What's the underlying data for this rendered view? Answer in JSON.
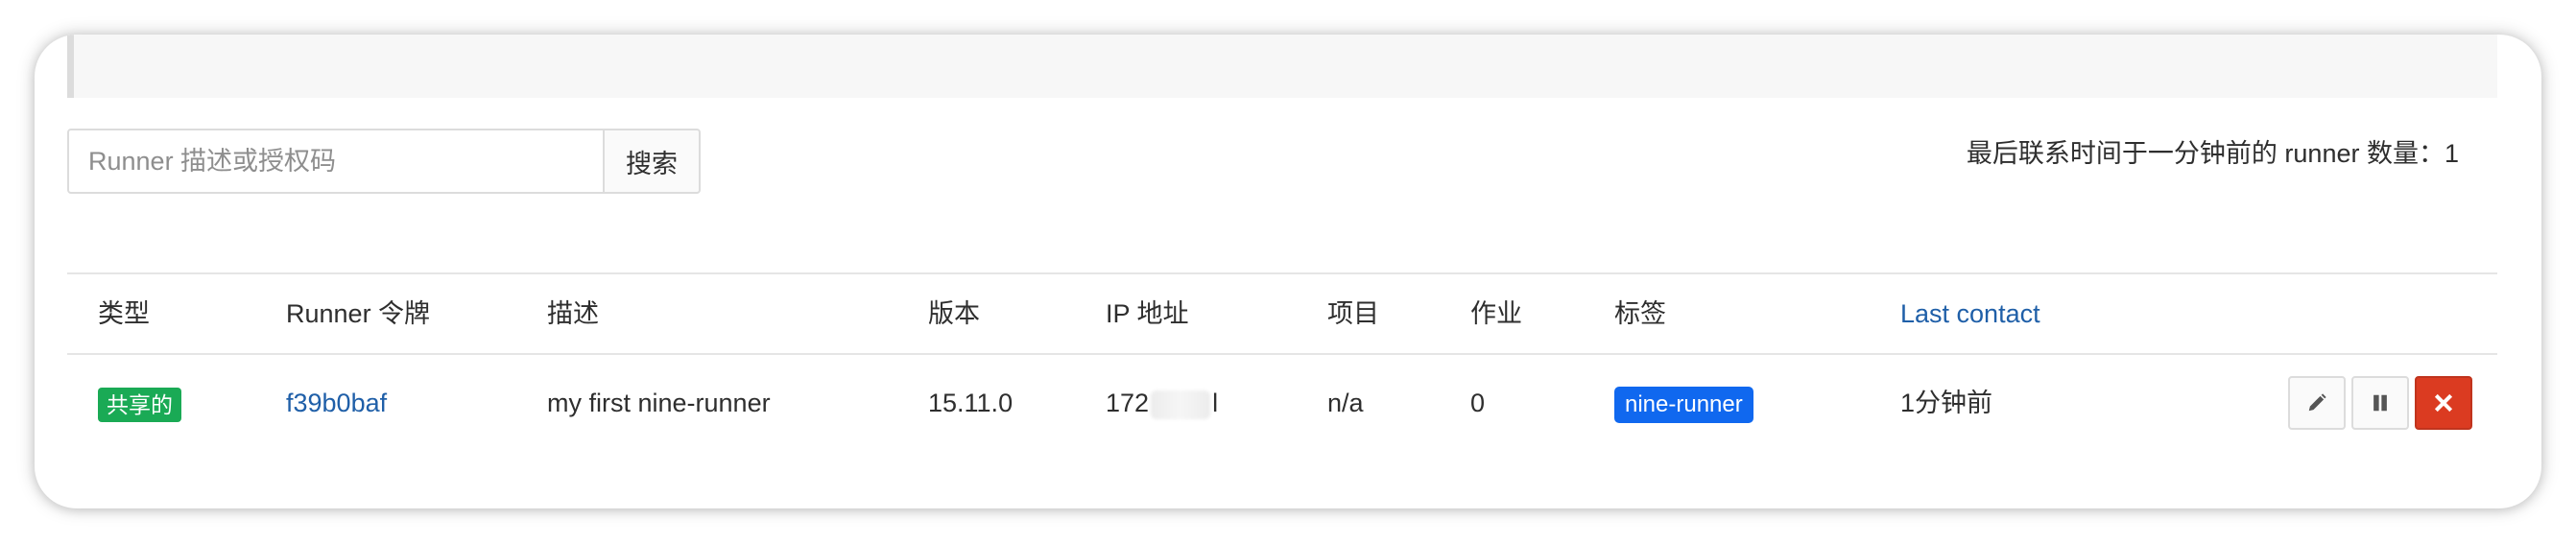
{
  "search": {
    "placeholder": "Runner 描述或授权码",
    "value": "",
    "button_label": "搜索"
  },
  "online_count_text": "最后联系时间于一分钟前的 runner 数量：1",
  "table": {
    "headers": {
      "type": "类型",
      "token": "Runner 令牌",
      "description": "描述",
      "version": "版本",
      "ip": "IP 地址",
      "projects": "项目",
      "jobs": "作业",
      "tags": "标签",
      "last_contact": "Last contact"
    },
    "rows": [
      {
        "type_badge": "共享的",
        "token": "f39b0baf",
        "description": "my first nine-runner",
        "version": "15.11.0",
        "ip_prefix": "172",
        "ip_suffix": "l",
        "projects": "n/a",
        "jobs": "0",
        "tag": "nine-runner",
        "last_contact": "1分钟前"
      }
    ]
  },
  "actions": {
    "edit_icon": "pencil-icon",
    "pause_icon": "pause-icon",
    "remove_icon": "close-icon"
  },
  "colors": {
    "shared_badge": "#1aaa55",
    "tag_badge": "#1068ef",
    "link": "#1f5fa8",
    "remove_button": "#db3b21"
  }
}
